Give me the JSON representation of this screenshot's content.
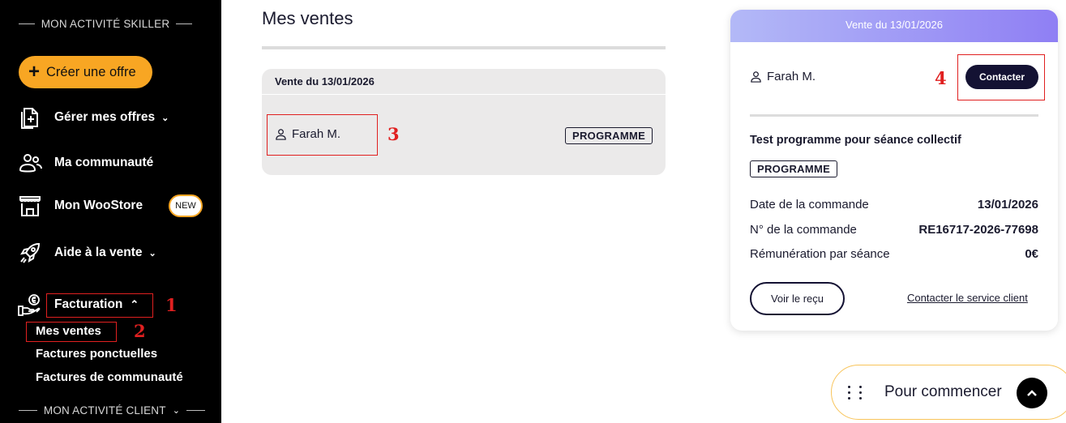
{
  "sidebar": {
    "section_skiller": "MON ACTIVITÉ SKILLER",
    "create_offer": "Créer une offre",
    "items": [
      {
        "label": "Gérer mes offres",
        "icon": "document-add-icon"
      },
      {
        "label": "Ma communauté",
        "icon": "people-icon"
      },
      {
        "label": "Mon WooStore",
        "icon": "store-icon",
        "badge": "NEW"
      },
      {
        "label": "Aide à la vente",
        "icon": "rocket-icon"
      },
      {
        "label": "Facturation",
        "icon": "money-hand-icon"
      }
    ],
    "billing_sub": [
      "Mes ventes",
      "Factures ponctuelles",
      "Factures de communauté"
    ],
    "section_client": "MON ACTIVITÉ CLIENT"
  },
  "annotations": [
    "1",
    "2",
    "3",
    "4"
  ],
  "main": {
    "title": "Mes ventes",
    "sale": {
      "header": "Vente du 13/01/2026",
      "customer": "Farah M.",
      "tag": "PROGRAMME"
    }
  },
  "detail": {
    "header": "Vente du 13/01/2026",
    "customer": "Farah M.",
    "contact_label": "Contacter",
    "program_title": "Test programme pour séance collectif",
    "tag": "PROGRAMME",
    "rows": [
      {
        "label": "Date de la commande",
        "value": "13/01/2026"
      },
      {
        "label": "N° de la commande",
        "value": "RE16717-2026-77698"
      },
      {
        "label": "Rémunération par séance",
        "value": "0€"
      }
    ],
    "receipt_label": "Voir le reçu",
    "support_label": "Contacter le service client"
  },
  "helper": {
    "label": "Pour commencer"
  },
  "colors": {
    "accent": "#f8a623",
    "dark": "#141233",
    "annotation": "#e02020",
    "gradient_start": "#b3b9f7",
    "gradient_end": "#8f7ff4"
  }
}
